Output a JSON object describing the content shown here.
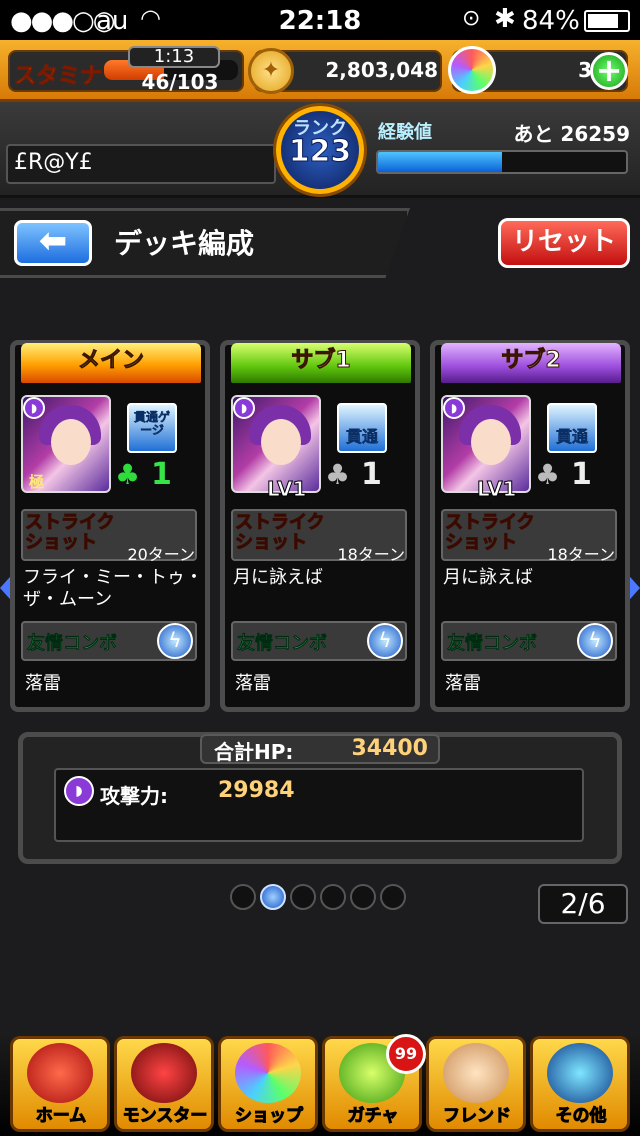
{
  "status_bar": {
    "signal": "●●●○○",
    "carrier": "au",
    "time": "22:18",
    "battery": "84%",
    "battery_level": 0.84
  },
  "header": {
    "stamina_label": "スタミナ",
    "stamina_timer": "1:13",
    "stamina_value": "46/103",
    "gold_value": "2,803,048",
    "orb_value": "3",
    "rank_label": "ランク",
    "rank_value": "123",
    "exp_label": "経験値",
    "exp_remaining": "あと 26259",
    "player_name": "£R@Y£",
    "colors": {
      "accent": "#f6b12c",
      "exp_bar": "#1a8fff"
    }
  },
  "title_row": {
    "back_glyph": "⬅",
    "title": "デッキ編成",
    "reset_label": "リセット"
  },
  "cards": [
    {
      "slot": "メイン",
      "portrait_tag": "極",
      "ability": "貫通ゲージ",
      "luck": "1",
      "strike_label": "ストライク\nショット",
      "turns": "20ターン",
      "skill_name": "フライ・ミー・トゥ・ザ・ムーン",
      "combo_label": "友情コンボ",
      "combo_name": "落雷"
    },
    {
      "slot": "サブ1",
      "level": "LV1",
      "ability": "貫通",
      "luck": "1",
      "strike_label": "ストライク\nショット",
      "turns": "18ターン",
      "skill_name": "月に詠えば",
      "combo_label": "友情コンボ",
      "combo_name": "落雷"
    },
    {
      "slot": "サブ2",
      "level": "LV1",
      "ability": "貫通",
      "luck": "1",
      "strike_label": "ストライク\nショット",
      "turns": "18ターン",
      "skill_name": "月に詠えば",
      "combo_label": "友情コンボ",
      "combo_name": "落雷"
    }
  ],
  "summary": {
    "hp_label": "合計HP:",
    "hp_value": "34400",
    "atk_label": "攻撃力:",
    "atk_value": "29984"
  },
  "pager": {
    "page_counter": "2/6",
    "current_page": 2,
    "total_pages": 6
  },
  "bottom_nav": {
    "items": [
      "ホーム",
      "モンスター",
      "ショップ",
      "ガチャ",
      "フレンド",
      "その他"
    ],
    "gacha_badge": "99"
  }
}
